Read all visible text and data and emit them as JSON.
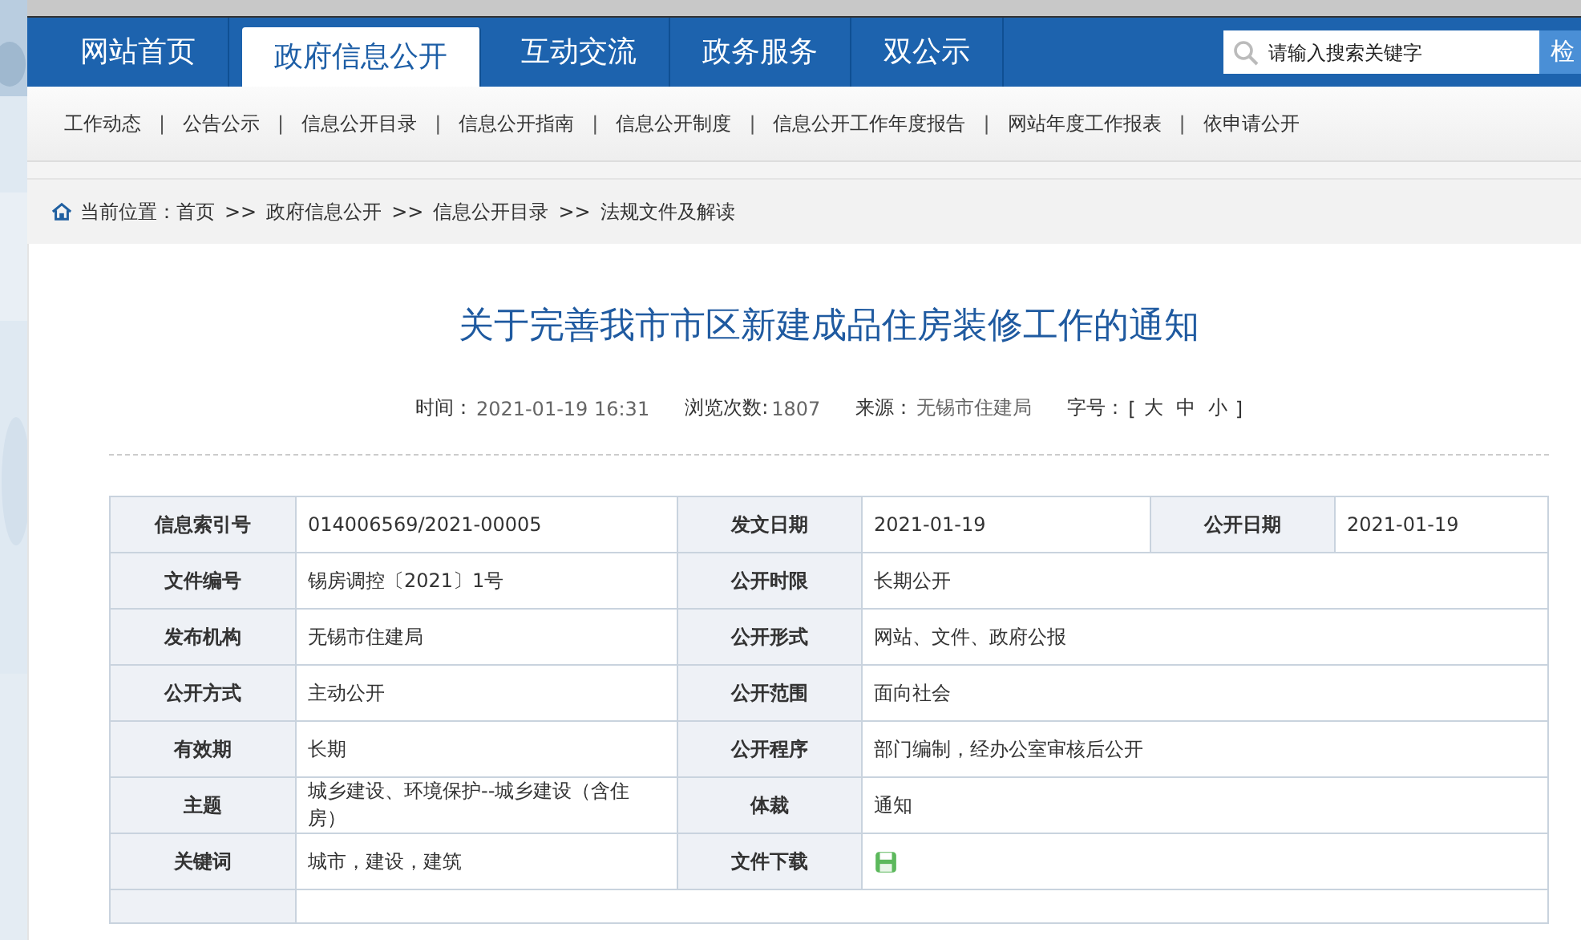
{
  "nav": {
    "tabs": [
      {
        "label": "网站首页",
        "selected": false
      },
      {
        "label": "政府信息公开",
        "selected": true
      },
      {
        "label": "互动交流",
        "selected": false
      },
      {
        "label": "政务服务",
        "selected": false
      },
      {
        "label": "双公示",
        "selected": false
      }
    ],
    "search": {
      "placeholder": "请输入搜索关键字",
      "button": "检"
    }
  },
  "subnav": {
    "separator": "|",
    "links": [
      "工作动态",
      "公告公示",
      "信息公开目录",
      "信息公开指南",
      "信息公开制度",
      "信息公开工作年度报告",
      "网站年度工作报表",
      "依申请公开"
    ]
  },
  "breadcrumb": {
    "label": "当前位置：",
    "separator": ">>",
    "items": [
      "首页",
      "政府信息公开",
      "信息公开目录",
      "法规文件及解读"
    ]
  },
  "article": {
    "title": "关于完善我市市区新建成品住房装修工作的通知",
    "meta": [
      {
        "label": "时间：",
        "value": "2021-01-19 16:31"
      },
      {
        "label": "浏览次数:",
        "value": "1807"
      },
      {
        "label": "来源：",
        "value": "无锡市住建局"
      }
    ],
    "font_size": {
      "label": "字号：",
      "open": "[",
      "sizes": [
        "大",
        "中",
        "小"
      ],
      "close": "]"
    }
  },
  "info_table": {
    "rows": [
      [
        {
          "kind": "label",
          "text": "信息索引号"
        },
        {
          "kind": "value",
          "text": "014006569/2021-00005"
        },
        {
          "kind": "label",
          "text": "发文日期"
        },
        {
          "kind": "value",
          "text": "2021-01-19"
        },
        {
          "kind": "label",
          "text": "公开日期"
        },
        {
          "kind": "value",
          "text": "2021-01-19"
        }
      ],
      [
        {
          "kind": "label",
          "text": "文件编号"
        },
        {
          "kind": "value",
          "text": "锡房调控〔2021〕1号"
        },
        {
          "kind": "label",
          "text": "公开时限"
        },
        {
          "kind": "value",
          "text": "长期公开",
          "colspan": 3
        }
      ],
      [
        {
          "kind": "label",
          "text": "发布机构"
        },
        {
          "kind": "value",
          "text": "无锡市住建局"
        },
        {
          "kind": "label",
          "text": "公开形式"
        },
        {
          "kind": "value",
          "text": "网站、文件、政府公报",
          "colspan": 3
        }
      ],
      [
        {
          "kind": "label",
          "text": "公开方式"
        },
        {
          "kind": "value",
          "text": "主动公开"
        },
        {
          "kind": "label",
          "text": "公开范围"
        },
        {
          "kind": "value",
          "text": "面向社会",
          "colspan": 3
        }
      ],
      [
        {
          "kind": "label",
          "text": "有效期"
        },
        {
          "kind": "value",
          "text": "长期"
        },
        {
          "kind": "label",
          "text": "公开程序"
        },
        {
          "kind": "value",
          "text": "部门编制，经办公室审核后公开",
          "colspan": 3
        }
      ],
      [
        {
          "kind": "label",
          "text": "主题"
        },
        {
          "kind": "value",
          "text": "城乡建设、环境保护--城乡建设（含住房）"
        },
        {
          "kind": "label",
          "text": "体裁"
        },
        {
          "kind": "value",
          "text": "通知",
          "colspan": 3
        }
      ],
      [
        {
          "kind": "label",
          "text": "关键词"
        },
        {
          "kind": "value",
          "text": "城市，建设，建筑"
        },
        {
          "kind": "label",
          "text": "文件下载"
        },
        {
          "kind": "download",
          "colspan": 3
        }
      ]
    ]
  }
}
